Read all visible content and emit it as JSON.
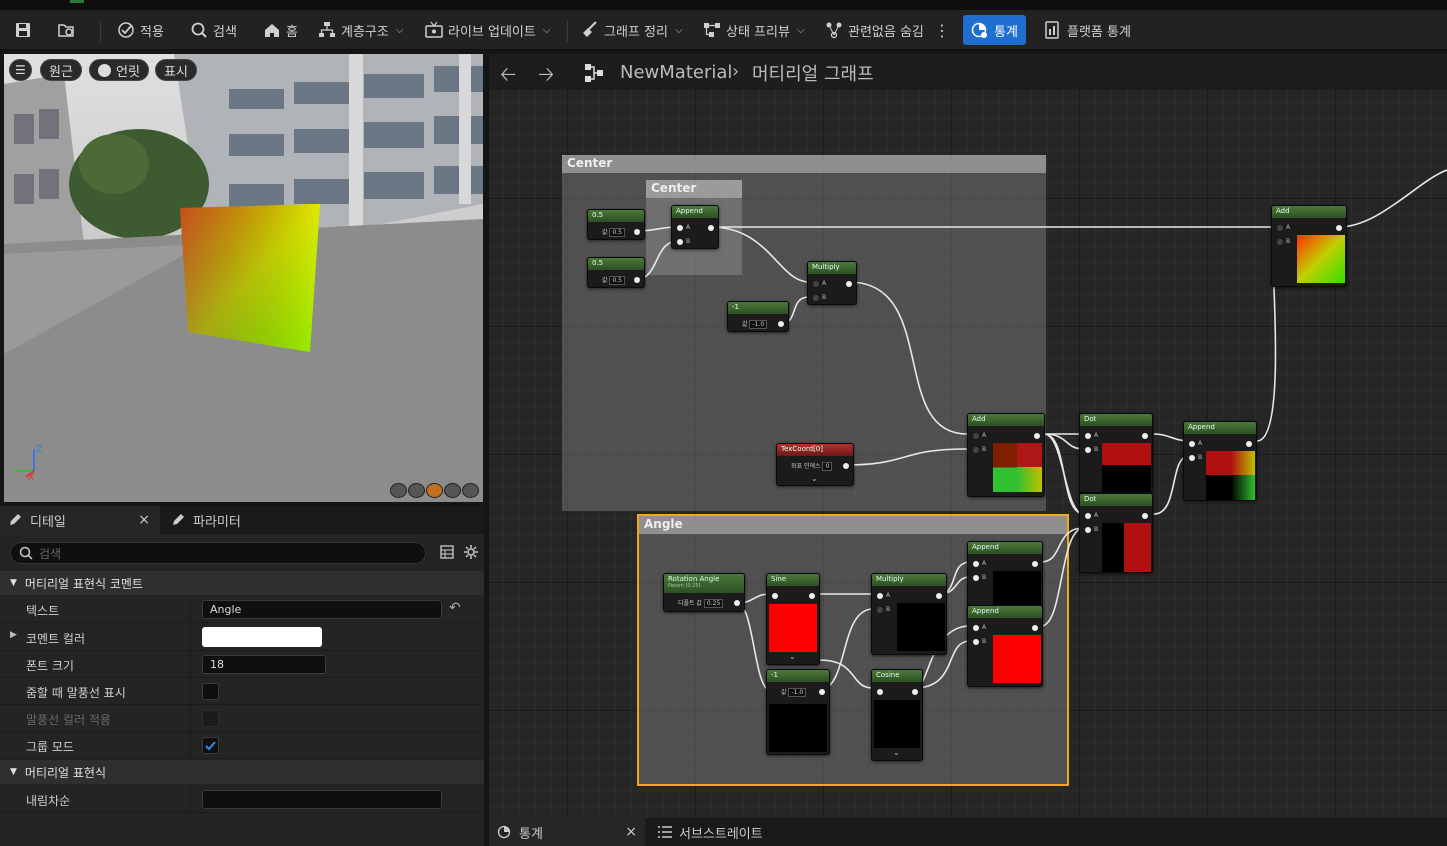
{
  "toolbar": {
    "apply": "적용",
    "search": "검색",
    "home": "홈",
    "hierarchy": "계층구조",
    "live_update": "라이브 업데이트",
    "graph_cleanup": "그래프 정리",
    "state_preview": "상태 프리뷰",
    "hide_unrelated": "관련없음 숨김",
    "stats": "통계",
    "platform_stats": "플랫폼 통계"
  },
  "viewport": {
    "perspective": "원근",
    "lit": "언릿",
    "show": "표시",
    "axis_z": "Z",
    "axis_x": "X"
  },
  "left_panel": {
    "tab_details": "디테일",
    "tab_parameters": "파라미터",
    "search_placeholder": "검색",
    "section_comment": "머티리얼 표현식 코멘트",
    "row_text_label": "텍스트",
    "row_text_value": "Angle",
    "row_color_label": "코멘트 컬러",
    "row_font_label": "폰트 크기",
    "row_font_value": "18",
    "row_bubble_label": "줌할 때 말풍선 표시",
    "row_bubble_color_label": "말풍선 컬러 적용",
    "row_group_label": "그룹 모드",
    "section_expression": "머티리얼 표현식",
    "row_desc_label": "내림차순",
    "comment_color": "#ffffff"
  },
  "graph": {
    "breadcrumb_root": "NewMaterial",
    "breadcrumb_child": "머티리얼 그래프",
    "comment_center_outer": "Center",
    "comment_center_inner": "Center",
    "comment_angle": "Angle",
    "nodes": {
      "const1_title": "0.5",
      "const1_value": "0.5",
      "const2_title": "0.5",
      "const2_value": "0.5",
      "append1_title": "Append",
      "multiply1_title": "Multiply",
      "neg1_title": "-1",
      "neg1_value": "-1.0",
      "texcoord_title": "TexCoord[0]",
      "texcoord_value": "0",
      "add_main_title": "Add",
      "dot1_title": "Dot",
      "dot2_title": "Dot",
      "append_final_title": "Append",
      "add_top_title": "Add",
      "rot_title": "Rotation Angle",
      "rot_sub": "Param (0.25)",
      "rot_value": "0.25",
      "sine_title": "Sine",
      "neg2_title": "-1",
      "neg2_value": "-1.0",
      "multiply2_title": "Multiply",
      "cosine_title": "Cosine",
      "append2_title": "Append",
      "append3_title": "Append",
      "pin_a": "A",
      "pin_b": "B",
      "label_value": "값",
      "label_default": "디폴트 값",
      "label_coord": "좌표 인덱스"
    }
  },
  "bottom_tabs": {
    "stats": "통계",
    "substrate": "서브스트레이트"
  },
  "colors": {
    "accent": "#1e6fd0",
    "selection": "#f0a820",
    "node_green": "#3d6a30",
    "node_red": "#a02828"
  }
}
